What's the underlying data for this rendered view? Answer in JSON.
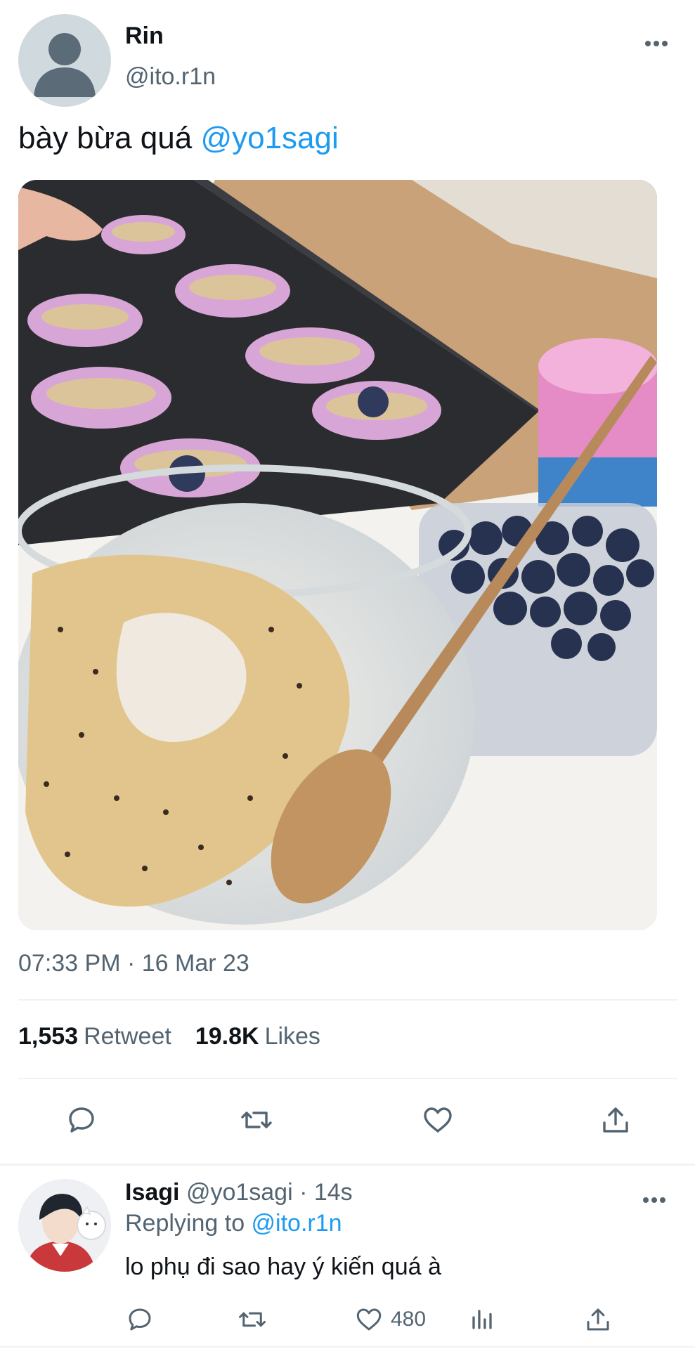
{
  "tweet": {
    "author": {
      "name": "Rin",
      "handle": "@ito.r1n"
    },
    "text": "bày bừa quá ",
    "mention": "@yo1sagi",
    "photo": {
      "subject": "muffin batter and blueberries"
    },
    "timestamp": "07:33 PM · 16 Mar 23",
    "stats": {
      "retweets_count": "1,553",
      "retweets_label": "Retweet",
      "likes_count": "19.8K",
      "likes_label": "Likes"
    },
    "actions": [
      "reply-icon",
      "retweet-icon",
      "like-icon",
      "share-icon"
    ]
  },
  "reply": {
    "name": "Isagi",
    "handle_meta": "@yo1sagi · 14s",
    "replying_prefix": "Replying to ",
    "replying_handle": "@ito.r1n",
    "text": "lo phụ đi sao hay ý kiến quá à",
    "like_count": "480",
    "actions": [
      "reply-icon",
      "retweet-icon",
      "like-icon",
      "analytics-icon",
      "share-icon"
    ]
  },
  "colors": {
    "accent": "#1d9bf0",
    "secondary_text": "#536471",
    "primary_text": "#0f1419",
    "divider": "#eff3f4"
  }
}
